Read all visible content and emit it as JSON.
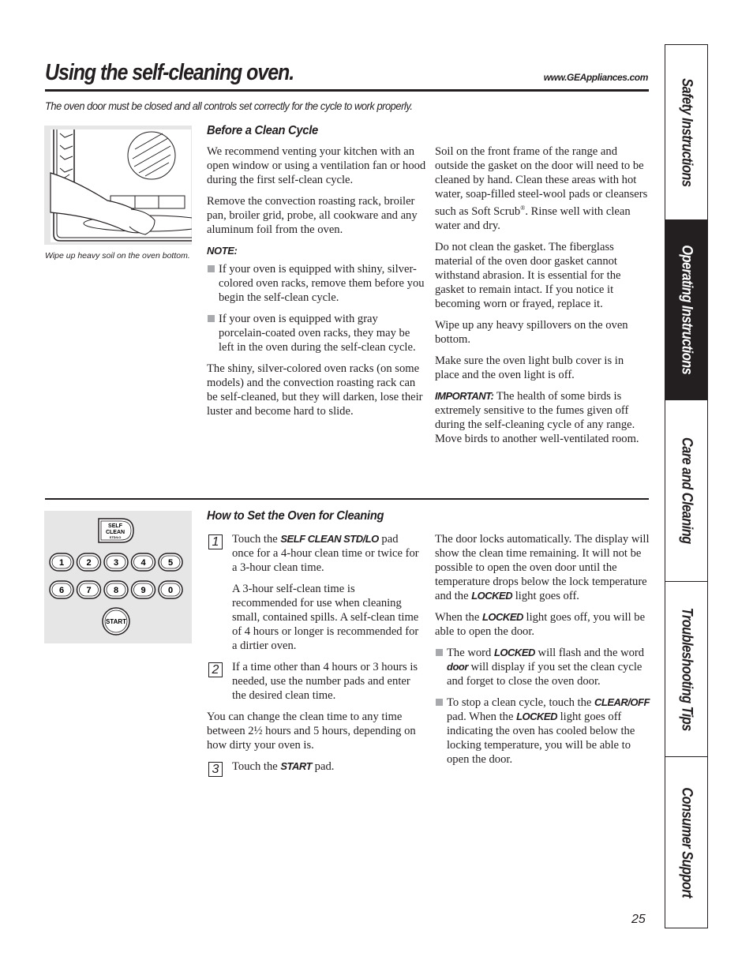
{
  "header": {
    "title": "Using the self-cleaning oven.",
    "url": "www.GEAppliances.com",
    "subtitle": "The oven door must be closed and all controls set correctly for the cycle to work properly."
  },
  "figures": {
    "oven": {
      "icon": "oven-wipe-illustration",
      "caption": "Wipe up heavy soil on the oven bottom."
    },
    "keypad": {
      "self_clean_label": [
        "SELF",
        "CLEAN",
        "STD/LO"
      ],
      "number_keys_row1": [
        "1",
        "2",
        "3",
        "4",
        "5"
      ],
      "number_keys_row2": [
        "6",
        "7",
        "8",
        "9",
        "0"
      ],
      "start_label": "START"
    }
  },
  "before": {
    "heading": "Before a Clean Cycle",
    "left": {
      "p1": "We recommend venting your kitchen with an open window or using a ventilation fan or hood during the first self-clean cycle.",
      "p2": "Remove the convection roasting rack, broiler pan, broiler grid, probe, all cookware and any aluminum foil from the oven.",
      "note_label": "NOTE:",
      "bullets": [
        "If your oven is equipped with shiny, silver-colored oven racks, remove them before you begin the self-clean cycle.",
        "If your oven is equipped with gray porcelain-coated oven racks, they may be left in the oven during the self-clean cycle."
      ],
      "p3": "The shiny, silver-colored oven racks (on some models) and the convection roasting rack can be self-cleaned, but they will darken, lose their luster and become hard to slide."
    },
    "right": {
      "p1_a": "Soil on the front frame of the range and outside the gasket on the door will need to be cleaned by hand. Clean these areas with hot water, soap-filled steel-wool pads or cleansers such as Soft Scrub",
      "p1_reg": "®",
      "p1_b": ". Rinse well with clean water and dry.",
      "p2": "Do not clean the gasket. The fiberglass material of the oven door gasket cannot withstand abrasion. It is essential for the gasket to remain intact. If you notice it becoming worn or frayed, replace it.",
      "p3": "Wipe up any heavy spillovers on the oven bottom.",
      "p4": "Make sure the oven light bulb cover is in place and the oven light is off.",
      "important_label": "IMPORTANT:",
      "p5": " The health of some birds is extremely sensitive to the fumes given off during the self-cleaning cycle of any range. Move birds to another well-ventilated room."
    }
  },
  "howto": {
    "heading": "How to Set the Oven for Cleaning",
    "steps": [
      {
        "num": "1",
        "pre": "Touch the ",
        "kw": "SELF CLEAN STD/LO",
        "post": " pad once for a 4-hour clean time or twice for a 3-hour clean time."
      },
      {
        "num": "2",
        "text": "If a time other than 4 hours or 3 hours is needed, use the number pads and enter the desired clean time."
      },
      {
        "num": "3",
        "pre": "Touch the ",
        "kw": "START",
        "post": " pad."
      }
    ],
    "step1_sub": "A 3-hour self-clean time is recommended for use when cleaning small, contained spills. A self-clean time of 4 hours or longer is recommended for a dirtier oven.",
    "change_time": "You can change the clean time to any time between 2½ hours and 5 hours, depending on how dirty your oven is.",
    "right": {
      "p1_pre": "The door locks automatically. The display will show the clean time remaining. It will not be possible to open the oven door until the temperature drops below the lock temperature and the ",
      "p1_kw": "LOCKED",
      "p1_post": " light goes off.",
      "p2_pre": "When the ",
      "p2_kw": "LOCKED",
      "p2_post": " light goes off, you will be able to open the door.",
      "b1_pre": "The word ",
      "b1_kw1": "LOCKED",
      "b1_mid": " will flash and the word ",
      "b1_kw2": "door",
      "b1_post": " will display if you set the clean cycle and forget to close the oven door.",
      "b2_pre": "To stop a clean cycle, touch the ",
      "b2_kw1": "CLEAR/OFF",
      "b2_mid": " pad. When the ",
      "b2_kw2": "LOCKED",
      "b2_post": " light goes off indicating the oven has cooled below the locking temperature, you will be able to open the door."
    }
  },
  "side_tabs": [
    {
      "label": "Safety Instructions",
      "active": false
    },
    {
      "label": "Operating Instructions",
      "active": true
    },
    {
      "label": "Care and Cleaning",
      "active": false
    },
    {
      "label": "Troubleshooting Tips",
      "active": false
    },
    {
      "label": "Consumer Support",
      "active": false
    }
  ],
  "page_number": "25"
}
